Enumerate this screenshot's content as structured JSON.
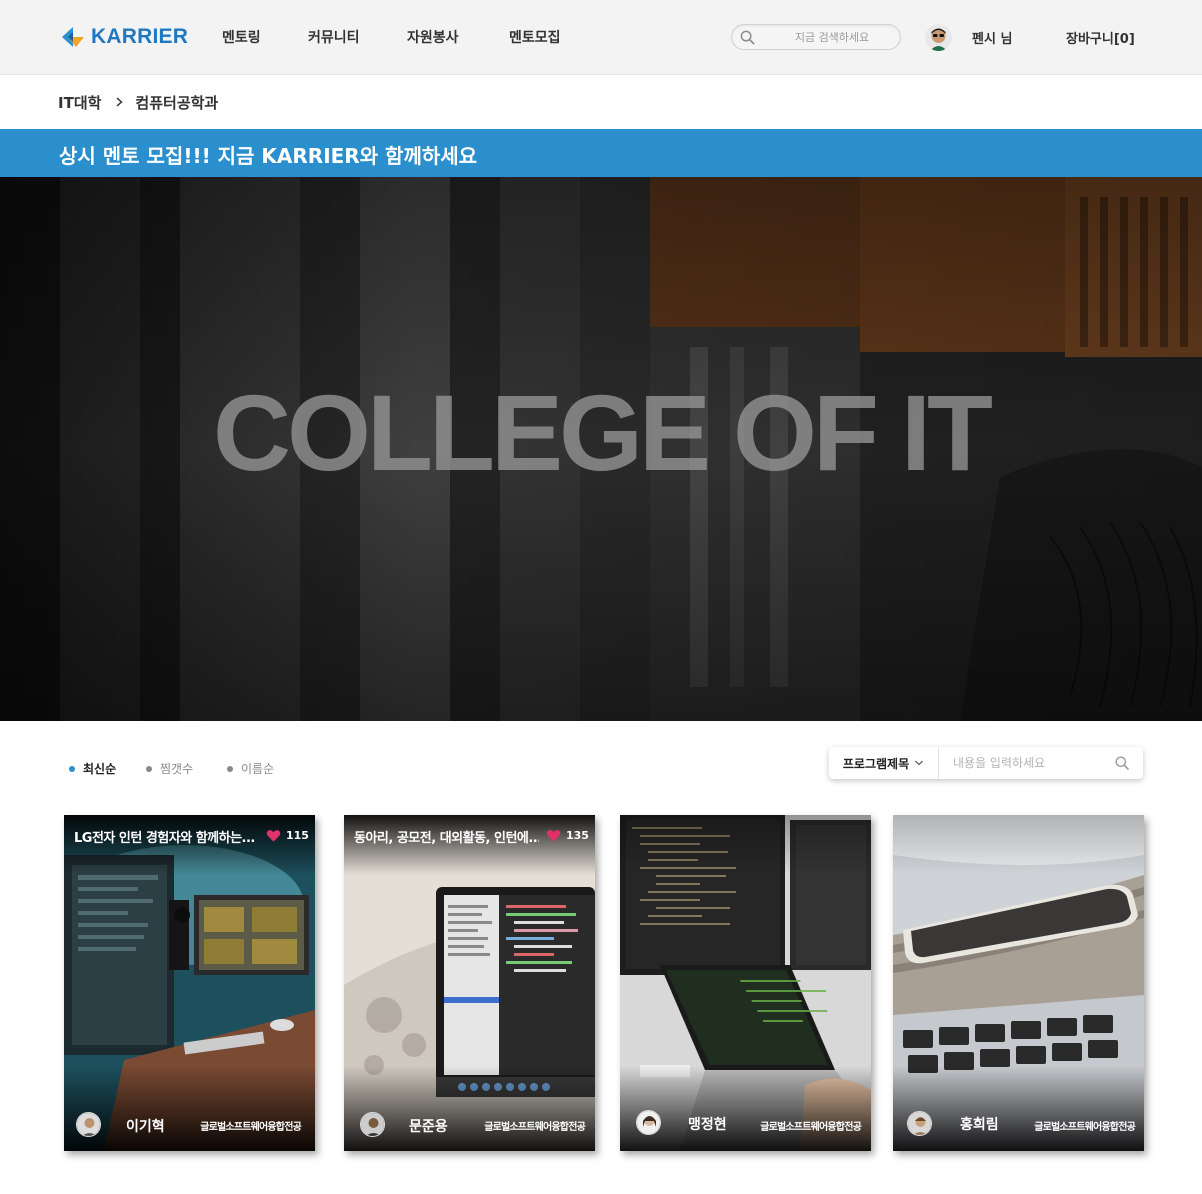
{
  "header": {
    "logo_text": "KARRIER",
    "nav": [
      "멘토링",
      "커뮤니티",
      "자원봉사",
      "멘토모집"
    ],
    "search_placeholder": "지금 검색하세요",
    "username": "펜시 님",
    "cart_label": "장바구니[0]"
  },
  "breadcrumb": [
    "IT대학",
    "컴퓨터공학과"
  ],
  "banner": {
    "text": "상시 멘토 모집!!! 지금 KARRIER와 함께하세요"
  },
  "hero": {
    "title": "COLLEGE OF IT"
  },
  "sort_tabs": [
    {
      "label": "최신순",
      "active": true
    },
    {
      "label": "찜갯수",
      "active": false
    },
    {
      "label": "이름순",
      "active": false
    }
  ],
  "filter": {
    "select_value": "프로그램제목",
    "input_placeholder": "내용을 입력하세요"
  },
  "cards": [
    {
      "title": "LG전자 인턴 경험자와 함께하는...",
      "likes": "115",
      "name": "이기혁",
      "major": "글로벌소프트웨어융합전공"
    },
    {
      "title": "동아리, 공모전, 대외활동, 인턴에...",
      "likes": "135",
      "name": "문준용",
      "major": "글로벌소프트웨어융합전공"
    },
    {
      "title": "",
      "likes": "",
      "name": "맹정현",
      "major": "글로벌소프트웨어융합전공"
    },
    {
      "title": "",
      "likes": "",
      "name": "홍희림",
      "major": "글로벌소프트웨어융합전공"
    }
  ],
  "colors": {
    "accent": "#2b8fcd",
    "brand": "#1f78c0",
    "heart": "#e0316b"
  },
  "icons": [
    "logo-mark-icon",
    "search-icon",
    "chevron-right-icon",
    "chevron-down-icon",
    "heart-icon"
  ]
}
